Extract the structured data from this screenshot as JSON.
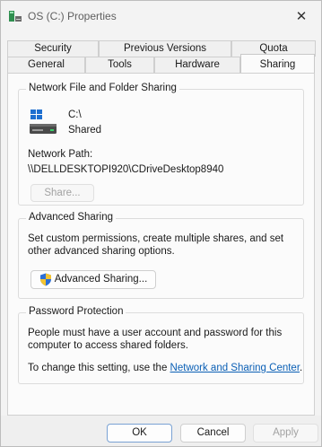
{
  "window": {
    "title": "OS (C:) Properties",
    "title_icon": "drive-properties-icon",
    "close_glyph": "✕"
  },
  "tabs": {
    "top_row": [
      {
        "label": "Security"
      },
      {
        "label": "Previous Versions"
      },
      {
        "label": "Quota"
      }
    ],
    "bottom_row": [
      {
        "label": "General"
      },
      {
        "label": "Tools"
      },
      {
        "label": "Hardware"
      },
      {
        "label": "Sharing",
        "active": true
      }
    ]
  },
  "network_sharing": {
    "title": "Network File and Folder Sharing",
    "drive_name": "C:\\",
    "drive_state": "Shared",
    "path_label": "Network Path:",
    "path_value": "\\\\DELLDESKTOPI920\\CDriveDesktop8940",
    "share_button": "Share..."
  },
  "advanced_sharing": {
    "title": "Advanced Sharing",
    "description": "Set custom permissions, create multiple shares, and set other advanced sharing options.",
    "button": "Advanced Sharing...",
    "button_icon": "uac-shield-icon"
  },
  "password_protection": {
    "title": "Password Protection",
    "description": "People must have a user account and password for this computer to access shared folders.",
    "change_prefix": "To change this setting, use the ",
    "link_text": "Network and Sharing Center",
    "change_suffix": "."
  },
  "footer": {
    "ok": "OK",
    "cancel": "Cancel",
    "apply": "Apply"
  },
  "colors": {
    "link": "#0a5fb5",
    "ok_border": "#2a5fa6"
  }
}
